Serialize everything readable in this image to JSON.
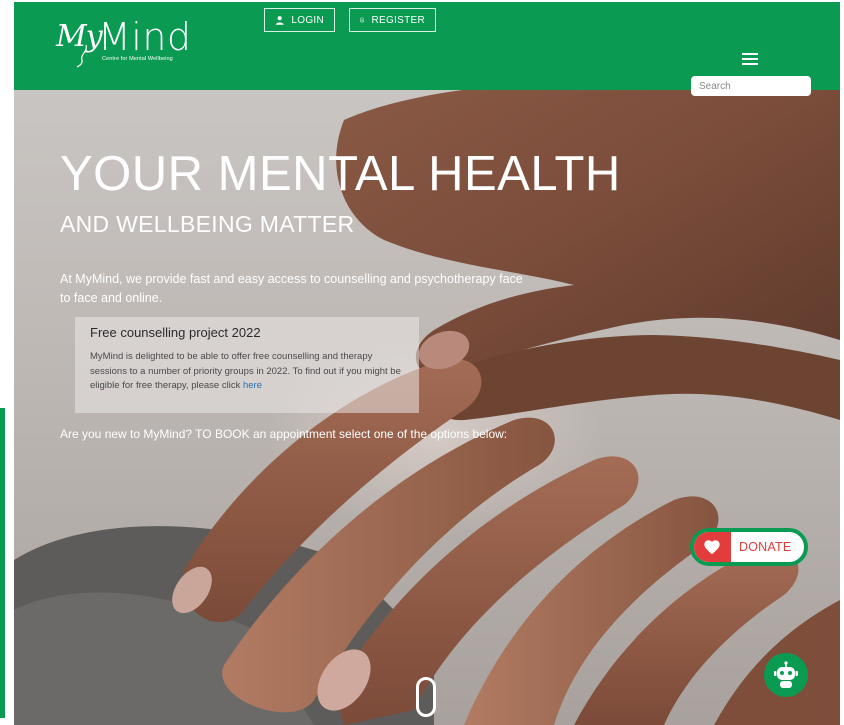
{
  "header": {
    "logo": {
      "brand_prefix": "My",
      "brand_name": "Mind",
      "tagline": "Centre for Mental Wellbeing"
    },
    "login_label": "LOGIN",
    "register_label": "REGISTER",
    "menu_icon": "hamburger-icon",
    "search_placeholder": "Search",
    "colors": {
      "brand_green": "#0a9a52"
    }
  },
  "hero": {
    "title": "YOUR MENTAL HEALTH",
    "subtitle": "AND WELLBEING MATTER",
    "description": "At MyMind, we provide fast and easy access to counselling and psychotherapy face to face and online.",
    "notice": {
      "title": "Free counselling project 2022",
      "body": "MyMind is delighted to be able to offer free counselling and therapy sessions to a number of priority groups in 2022. To find out if you might be eligible for free therapy, please click",
      "link_label": "here"
    },
    "booking_prompt": "Are you new to MyMind? TO BOOK an appointment select one of the options below:"
  },
  "donate": {
    "label": "DONATE",
    "icon": "heart-icon",
    "colors": {
      "accent": "#e23c3c"
    }
  },
  "chatbot": {
    "icon": "robot-icon"
  },
  "scroll": {
    "icon": "mouse-scroll-icon"
  }
}
